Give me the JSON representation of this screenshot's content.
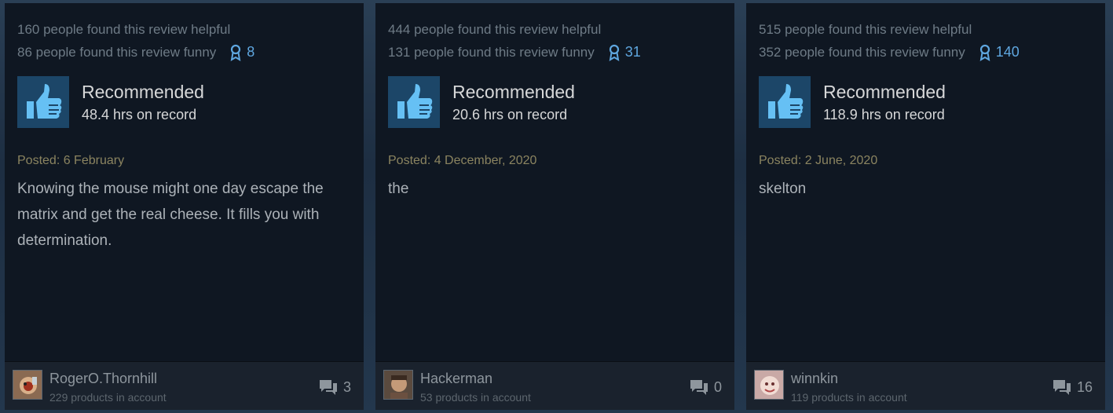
{
  "reviews": [
    {
      "helpful": "160 people found this review helpful",
      "funny": "86 people found this review funny",
      "awards": "8",
      "verdict": "Recommended",
      "hours": "48.4 hrs on record",
      "posted": "Posted: 6 February",
      "text": "Knowing the mouse might one day escape the matrix and get the real cheese. It fills you with determination.",
      "username": "RogerO.Thornhill",
      "products": "229 products in account",
      "comments": "3"
    },
    {
      "helpful": "444 people found this review helpful",
      "funny": "131 people found this review funny",
      "awards": "31",
      "verdict": "Recommended",
      "hours": "20.6 hrs on record",
      "posted": "Posted: 4 December, 2020",
      "text": "the",
      "username": "Hackerman",
      "products": "53 products in account",
      "comments": "0"
    },
    {
      "helpful": "515 people found this review helpful",
      "funny": "352 people found this review funny",
      "awards": "140",
      "verdict": "Recommended",
      "hours": "118.9 hrs on record",
      "posted": "Posted: 2 June, 2020",
      "text": "skelton",
      "username": "winnkin",
      "products": "119 products in account",
      "comments": "16"
    }
  ],
  "icons": {
    "award": "award-ribbon-icon",
    "thumb": "thumbs-up-icon",
    "comment": "comment-bubbles-icon"
  },
  "colors": {
    "card_bg": "#0f1722",
    "footer_bg": "#1a222d",
    "award_blue": "#5fa7e0",
    "thumb_bg": "#1c4668",
    "posted_tan": "#8b8460"
  }
}
